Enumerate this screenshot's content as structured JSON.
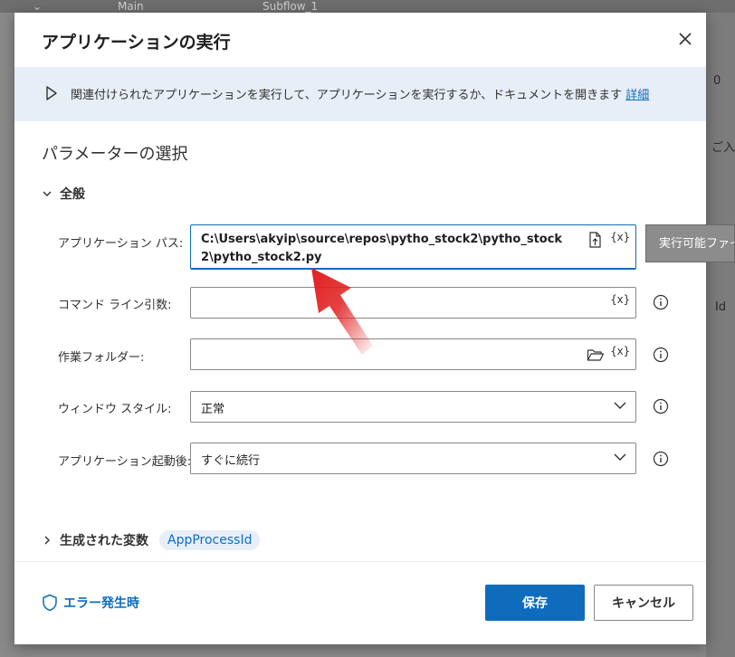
{
  "background": {
    "tabs": [
      "Main",
      "Subflow_1"
    ],
    "right_fragments": [
      "0",
      "ご入",
      "Id"
    ]
  },
  "dialog": {
    "title": "アプリケーションの実行",
    "info_text": "関連付けられたアプリケーションを実行して、アプリケーションを実行するか、ドキュメントを開きます",
    "info_link": "詳細",
    "section_title": "パラメーターの選択",
    "group_general": "全般",
    "fields": {
      "app_path": {
        "label": "アプリケーション パス:",
        "value": "C:\\Users\\akyip\\source\\repos\\pytho_stock2\\pytho_stock2\\pytho_stock2.py"
      },
      "cmd_args": {
        "label": "コマンド ライン引数:",
        "value": ""
      },
      "work_folder": {
        "label": "作業フォルダー:",
        "value": ""
      },
      "window_style": {
        "label": "ウィンドウ スタイル:",
        "value": "正常"
      },
      "after_launch": {
        "label": "アプリケーション起動後:",
        "value": "すぐに続行"
      }
    },
    "variable_token": "{x}",
    "tooltip": "実行可能ファイ",
    "generated_vars_label": "生成された変数",
    "generated_var": "AppProcessId",
    "error_link": "エラー発生時",
    "save_button": "保存",
    "cancel_button": "キャンセル"
  },
  "colors": {
    "accent": "#0f6cbd",
    "info_bar": "#e7eef8",
    "annotation_arrow": "#e02020"
  }
}
